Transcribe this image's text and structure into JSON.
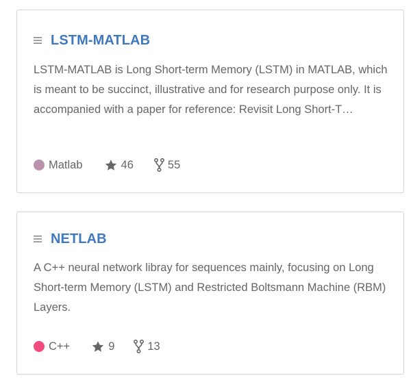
{
  "repos": [
    {
      "name": "LSTM-MATLAB",
      "description": "LSTM-MATLAB is Long Short-term Memory (LSTM) in MATLAB, which is meant to be succinct, illustrative and for research purpose only. It is accompanied with a paper for reference: Revisit Long Short-T…",
      "language": "Matlab",
      "language_color": "#bb92ac",
      "stars": "46",
      "forks": "55",
      "icons": {
        "menu": "menu-icon",
        "star": "star-icon",
        "fork": "fork-icon"
      }
    },
    {
      "name": "NETLAB",
      "description": "A C++ neural network libray for sequences mainly, focusing on Long Short-term Memory (LSTM) and Restricted Boltsmann Machine (RBM) Layers.",
      "language": "C++",
      "language_color": "#f34b7d",
      "stars": "9",
      "forks": "13",
      "icons": {
        "menu": "menu-icon",
        "star": "star-icon",
        "fork": "fork-icon"
      }
    }
  ],
  "colors": {
    "link": "#4078c0",
    "text": "#666666",
    "border": "#d1d5da"
  }
}
